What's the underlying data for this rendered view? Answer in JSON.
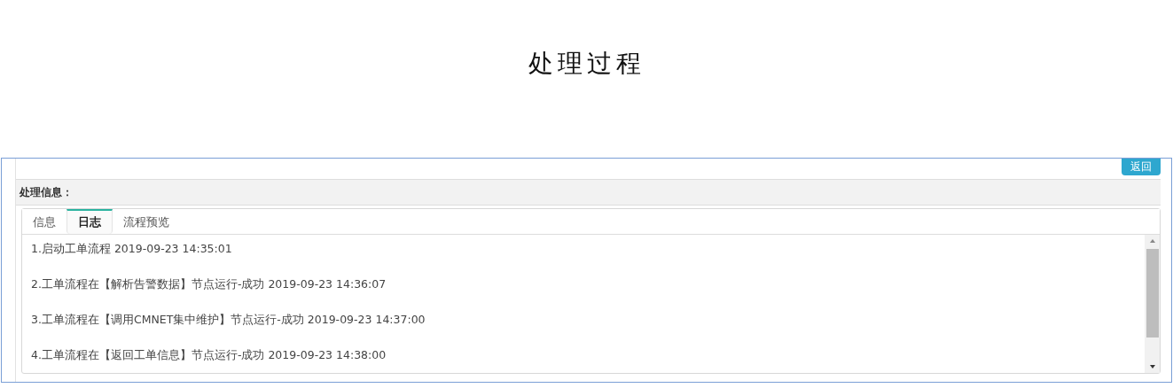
{
  "page_title": "处理过程",
  "back_button": "返回",
  "section_label": "处理信息：",
  "tabs": [
    {
      "label": "信息",
      "selected": false
    },
    {
      "label": "日志",
      "selected": true
    },
    {
      "label": "流程预览",
      "selected": false
    }
  ],
  "log_entries": [
    "1.启动工单流程 2019-09-23 14:35:01",
    "2.工单流程在【解析告警数据】节点运行-成功 2019-09-23 14:36:07",
    "3.工单流程在【调用CMNET集中维护】节点运行-成功 2019-09-23 14:37:00",
    "4.工单流程在【返回工单信息】节点运行-成功 2019-09-23 14:38:00"
  ]
}
